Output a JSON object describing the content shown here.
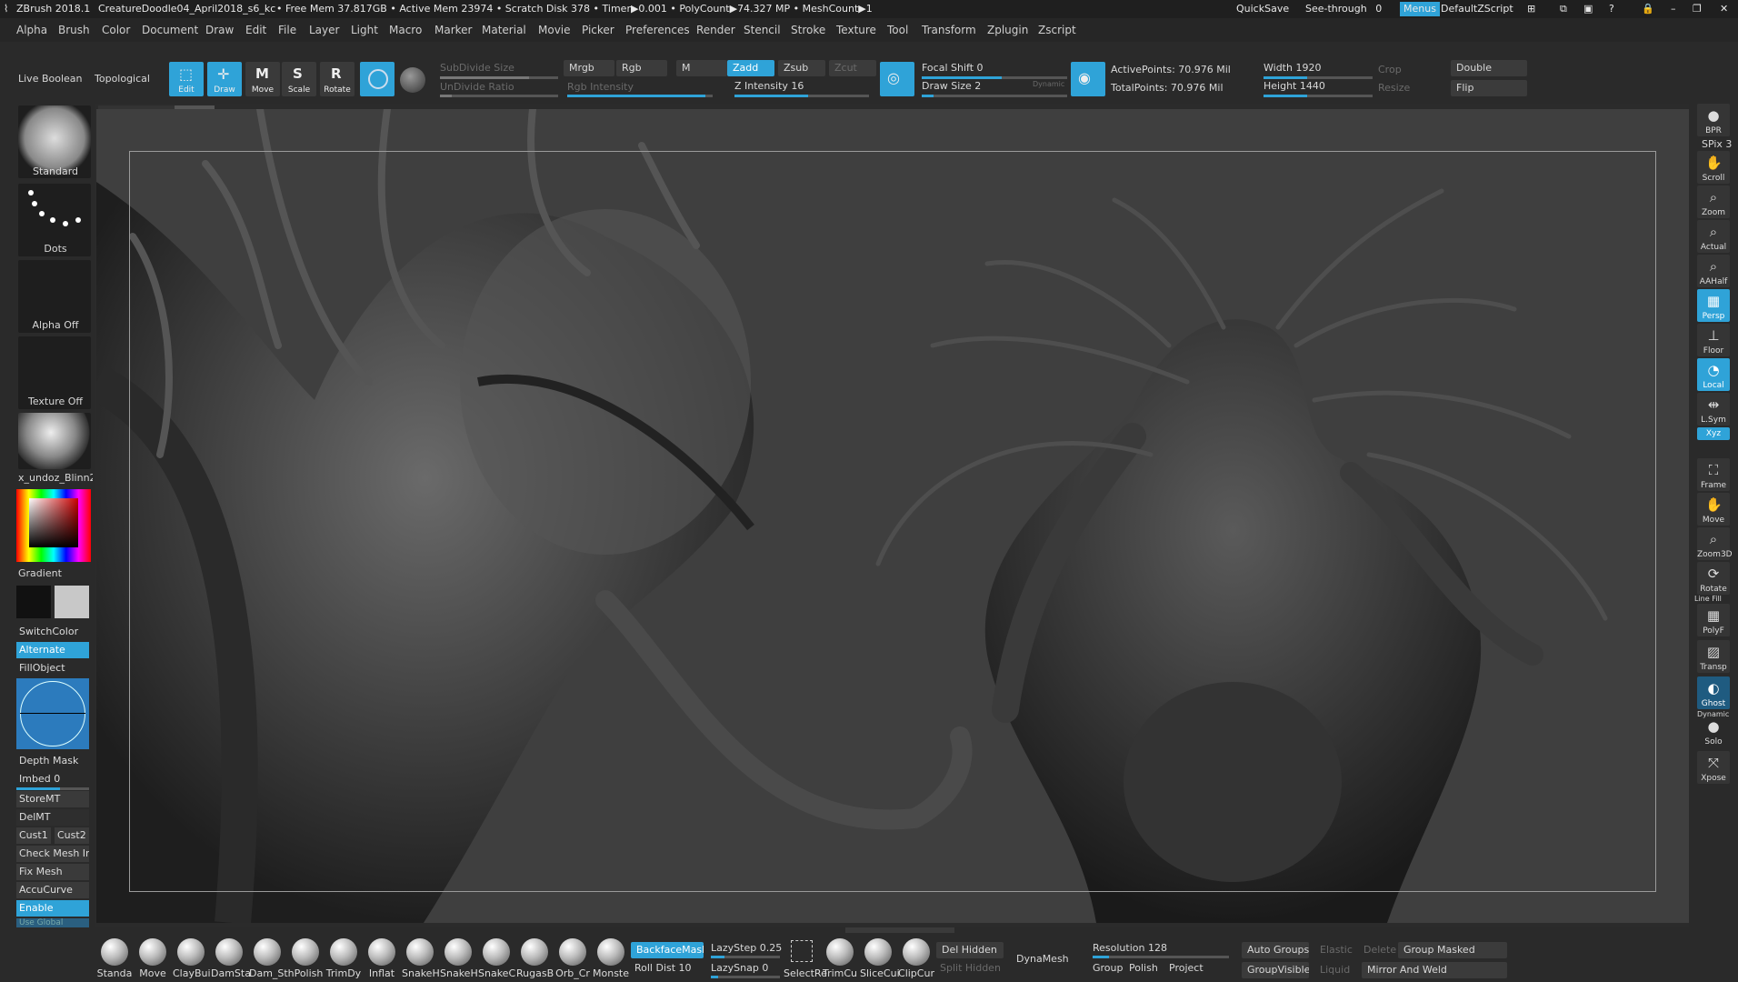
{
  "titlebar": {
    "app": "ZBrush 2018.1",
    "file": "CreatureDoodle04_April2018_s6_kc",
    "stats": "• Free Mem 37.817GB • Active Mem 23974 • Scratch Disk 378 • Timer▶0.001 • PolyCount▶74.327 MP • MeshCount▶1",
    "quicksave": "QuickSave",
    "seethrough": "See-through",
    "seethrough_value": "0",
    "menus": "Menus",
    "script": "DefaultZScript"
  },
  "menu": [
    "Alpha",
    "Brush",
    "Color",
    "Document",
    "Draw",
    "Edit",
    "File",
    "Layer",
    "Light",
    "Macro",
    "Marker",
    "Material",
    "Movie",
    "Picker",
    "Preferences",
    "Render",
    "Stencil",
    "Stroke",
    "Texture",
    "Tool",
    "Transform",
    "Zplugin",
    "Zscript"
  ],
  "shelf": {
    "live_boolean": "Live Boolean",
    "topological": "Topological",
    "tools": [
      {
        "label": "Edit",
        "icon": "edit-icon",
        "active": true
      },
      {
        "label": "Draw",
        "icon": "draw-icon",
        "active": true
      },
      {
        "label": "Move",
        "icon": "move-icon",
        "active": false
      },
      {
        "label": "Scale",
        "icon": "scale-icon",
        "active": false
      },
      {
        "label": "Rotate",
        "icon": "rotate-icon",
        "active": false
      }
    ],
    "subdivide_size": "SubDivide Size",
    "undivide_ratio": "UnDivide Ratio",
    "mrgb": "Mrgb",
    "rgb": "Rgb",
    "m": "M",
    "rgb_intensity": "Rgb Intensity",
    "zadd": "Zadd",
    "zsub": "Zsub",
    "zcut": "Zcut",
    "z_intensity": "Z Intensity 16",
    "focal_shift": "Focal Shift 0",
    "draw_size": "Draw Size 2",
    "dynamic": "Dynamic",
    "active_points": "ActivePoints: 70.976 Mil",
    "total_points": "TotalPoints: 70.976 Mil",
    "width": "Width 1920",
    "height": "Height 1440",
    "crop": "Crop",
    "resize": "Resize",
    "double": "Double",
    "flip": "Flip"
  },
  "left": {
    "brush": "Standard",
    "stroke": "Dots",
    "alpha": "Alpha Off",
    "texture": "Texture Off",
    "material": "x_undoz_Blinn2",
    "gradient": "Gradient",
    "switchcolor": "SwitchColor",
    "alternate": "Alternate",
    "fillobject": "FillObject",
    "depth_mask": "Depth Mask",
    "imbed": "Imbed 0",
    "storemt": "StoreMT",
    "delmt": "DelMT",
    "cust1": "Cust1",
    "cust2": "Cust2",
    "check_mesh": "Check Mesh In",
    "fix_mesh": "Fix Mesh",
    "accucurve": "AccuCurve",
    "enable": "Enable",
    "use_global": "Use Global"
  },
  "right": [
    {
      "label": "BPR",
      "icon": "bpr-icon",
      "active": false
    },
    {
      "label": "Scroll",
      "icon": "scroll-icon",
      "active": false
    },
    {
      "label": "Zoom",
      "icon": "zoom-icon",
      "active": false
    },
    {
      "label": "Actual",
      "icon": "actual-icon",
      "active": false
    },
    {
      "label": "AAHalf",
      "icon": "aahalf-icon",
      "active": false
    },
    {
      "label": "Persp",
      "icon": "persp-icon",
      "active": true
    },
    {
      "label": "Floor",
      "icon": "floor-icon",
      "active": false
    },
    {
      "label": "Local",
      "icon": "local-icon",
      "active": true
    },
    {
      "label": "L.Sym",
      "icon": "lsym-icon",
      "active": false
    },
    {
      "label": "Frame",
      "icon": "frame-icon",
      "active": false
    },
    {
      "label": "Move",
      "icon": "move-view-icon",
      "active": false
    },
    {
      "label": "Zoom3D",
      "icon": "zoom3d-icon",
      "active": false
    },
    {
      "label": "Rotate",
      "icon": "rotate-view-icon",
      "active": false
    },
    {
      "label": "PolyF",
      "icon": "polyf-icon",
      "active": false
    },
    {
      "label": "Transp",
      "icon": "transp-icon",
      "active": false
    },
    {
      "label": "Ghost",
      "icon": "ghost-icon",
      "active": true
    },
    {
      "label": "Solo",
      "icon": "solo-icon",
      "active": false
    },
    {
      "label": "Xpose",
      "icon": "xpose-icon",
      "active": false
    }
  ],
  "right_extra": {
    "spix": "SPix 3",
    "xyz": "Xyz",
    "dynamic": "Dynamic",
    "line_fill": "Line Fill"
  },
  "bottom": {
    "brushes": [
      "Standa",
      "Move",
      "ClayBui",
      "DamSta",
      "Dam_St",
      "hPolish",
      "TrimDy",
      "Inflat",
      "SnakeH",
      "SnakeH",
      "SnakeC",
      "RugasB",
      "Orb_Cr",
      "Monste"
    ],
    "backface": "BackfaceMask",
    "roll_dist": "Roll Dist 10",
    "lazystep": "LazyStep 0.25",
    "lazysnap": "LazySnap 0",
    "select_tools": [
      "SelectRe",
      "TrimCu",
      "SliceCui",
      "ClipCur"
    ],
    "del_hidden": "Del Hidden",
    "split_hidden": "Split Hidden",
    "dynamesh": "DynaMesh",
    "resolution": "Resolution 128",
    "group": "Group",
    "polish": "Polish",
    "project": "Project",
    "auto_groups": "Auto Groups",
    "elastic": "Elastic",
    "delete": "Delete",
    "group_masked": "Group Masked",
    "groupvisible": "GroupVisible",
    "liquid": "Liquid",
    "mirror_weld": "Mirror And Weld"
  }
}
